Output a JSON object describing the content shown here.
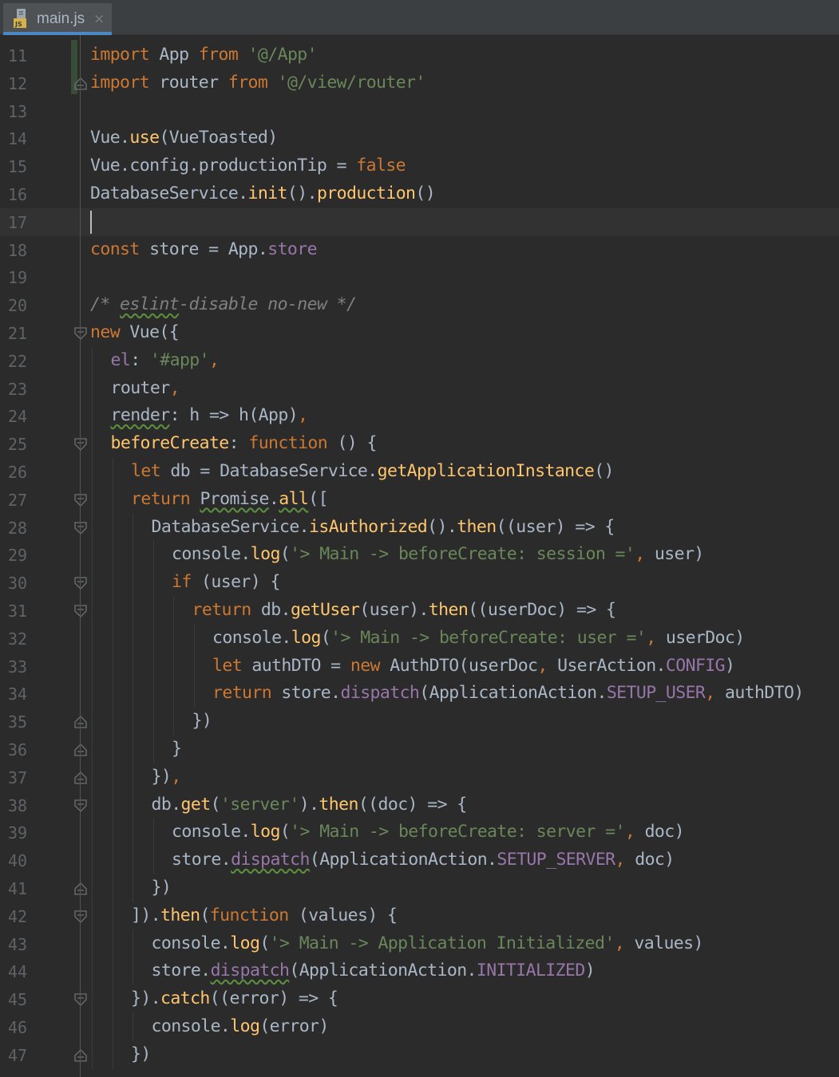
{
  "tab": {
    "file_name": "main.js",
    "icon": "js-file-icon",
    "icon_badge": "JS",
    "close_glyph": "×"
  },
  "colors": {
    "background": "#2b2b2b",
    "tab_underline": "#4a88c7",
    "keyword": "#cc7832",
    "string": "#6a8759",
    "function": "#ffc66d",
    "property": "#9876aa",
    "comment": "#808080",
    "text": "#a9b7c6"
  },
  "editor": {
    "current_line": 17,
    "lines": [
      {
        "n": "11",
        "fold": "",
        "indent": 0,
        "tokens": [
          {
            "t": "import",
            "c": "kw"
          },
          {
            "t": " App ",
            "c": "plain"
          },
          {
            "t": "from",
            "c": "kw"
          },
          {
            "t": " ",
            "c": "plain"
          },
          {
            "t": "'@/App'",
            "c": "str"
          }
        ]
      },
      {
        "n": "12",
        "fold": "end",
        "indent": 0,
        "tokens": [
          {
            "t": "import",
            "c": "kw"
          },
          {
            "t": " router ",
            "c": "plain"
          },
          {
            "t": "from",
            "c": "kw"
          },
          {
            "t": " ",
            "c": "plain"
          },
          {
            "t": "'@/view/router'",
            "c": "str"
          }
        ]
      },
      {
        "n": "13",
        "fold": "",
        "indent": 0,
        "tokens": []
      },
      {
        "n": "14",
        "fold": "",
        "indent": 0,
        "tokens": [
          {
            "t": "Vue.",
            "c": "plain"
          },
          {
            "t": "use",
            "c": "fn"
          },
          {
            "t": "(VueToasted)",
            "c": "plain"
          }
        ]
      },
      {
        "n": "15",
        "fold": "",
        "indent": 0,
        "tokens": [
          {
            "t": "Vue.config.productionTip = ",
            "c": "plain"
          },
          {
            "t": "false",
            "c": "kw"
          }
        ]
      },
      {
        "n": "16",
        "fold": "",
        "indent": 0,
        "tokens": [
          {
            "t": "DatabaseService.",
            "c": "plain"
          },
          {
            "t": "init",
            "c": "fn"
          },
          {
            "t": "().",
            "c": "plain"
          },
          {
            "t": "production",
            "c": "fn"
          },
          {
            "t": "()",
            "c": "plain"
          }
        ]
      },
      {
        "n": "17",
        "fold": "",
        "indent": 0,
        "tokens": []
      },
      {
        "n": "18",
        "fold": "",
        "indent": 0,
        "tokens": [
          {
            "t": "const",
            "c": "kw"
          },
          {
            "t": " store = App.",
            "c": "plain"
          },
          {
            "t": "store",
            "c": "prop"
          }
        ]
      },
      {
        "n": "19",
        "fold": "",
        "indent": 0,
        "tokens": []
      },
      {
        "n": "20",
        "fold": "",
        "indent": 0,
        "tokens": [
          {
            "t": "/* ",
            "c": "cm"
          },
          {
            "t": "eslint",
            "c": "cm",
            "w": true
          },
          {
            "t": "-disable no-new */",
            "c": "cm"
          }
        ]
      },
      {
        "n": "21",
        "fold": "start",
        "indent": 0,
        "tokens": [
          {
            "t": "new",
            "c": "kw"
          },
          {
            "t": " Vue({",
            "c": "plain"
          }
        ]
      },
      {
        "n": "22",
        "fold": "",
        "indent": 1,
        "tokens": [
          {
            "t": "el",
            "c": "prop"
          },
          {
            "t": ": ",
            "c": "plain"
          },
          {
            "t": "'#app'",
            "c": "str"
          },
          {
            "t": ",",
            "c": "kw"
          }
        ]
      },
      {
        "n": "23",
        "fold": "",
        "indent": 1,
        "tokens": [
          {
            "t": "router",
            "c": "plain"
          },
          {
            "t": ",",
            "c": "kw"
          }
        ]
      },
      {
        "n": "24",
        "fold": "",
        "indent": 1,
        "tokens": [
          {
            "t": "render",
            "c": "plain",
            "w": true
          },
          {
            "t": ": h => h(App)",
            "c": "plain"
          },
          {
            "t": ",",
            "c": "kw"
          }
        ]
      },
      {
        "n": "25",
        "fold": "start",
        "indent": 1,
        "tokens": [
          {
            "t": "beforeCreate",
            "c": "fn"
          },
          {
            "t": ": ",
            "c": "plain"
          },
          {
            "t": "function",
            "c": "kw"
          },
          {
            "t": " () {",
            "c": "plain"
          }
        ]
      },
      {
        "n": "26",
        "fold": "",
        "indent": 2,
        "tokens": [
          {
            "t": "let",
            "c": "kw"
          },
          {
            "t": " db = DatabaseService.",
            "c": "plain"
          },
          {
            "t": "getApplicationInstance",
            "c": "fn"
          },
          {
            "t": "()",
            "c": "plain"
          }
        ]
      },
      {
        "n": "27",
        "fold": "start",
        "indent": 2,
        "tokens": [
          {
            "t": "return",
            "c": "kw"
          },
          {
            "t": " ",
            "c": "plain"
          },
          {
            "t": "Promise",
            "c": "plain",
            "w": true
          },
          {
            "t": ".",
            "c": "plain"
          },
          {
            "t": "all",
            "c": "fn",
            "w": true
          },
          {
            "t": "([",
            "c": "plain"
          }
        ]
      },
      {
        "n": "28",
        "fold": "start",
        "indent": 3,
        "tokens": [
          {
            "t": "DatabaseService.",
            "c": "plain"
          },
          {
            "t": "isAuthorized",
            "c": "fn"
          },
          {
            "t": "().",
            "c": "plain"
          },
          {
            "t": "then",
            "c": "fn"
          },
          {
            "t": "((user) => {",
            "c": "plain"
          }
        ]
      },
      {
        "n": "29",
        "fold": "",
        "indent": 4,
        "tokens": [
          {
            "t": "console.",
            "c": "plain"
          },
          {
            "t": "log",
            "c": "fn"
          },
          {
            "t": "(",
            "c": "plain"
          },
          {
            "t": "'> Main -> beforeCreate: session ='",
            "c": "str"
          },
          {
            "t": ",",
            "c": "kw"
          },
          {
            "t": " user)",
            "c": "plain"
          }
        ]
      },
      {
        "n": "30",
        "fold": "start",
        "indent": 4,
        "tokens": [
          {
            "t": "if",
            "c": "kw"
          },
          {
            "t": " (user) {",
            "c": "plain"
          }
        ]
      },
      {
        "n": "31",
        "fold": "start",
        "indent": 5,
        "tokens": [
          {
            "t": "return",
            "c": "kw"
          },
          {
            "t": " db.",
            "c": "plain"
          },
          {
            "t": "getUser",
            "c": "fn"
          },
          {
            "t": "(user).",
            "c": "plain"
          },
          {
            "t": "then",
            "c": "fn"
          },
          {
            "t": "((userDoc) => {",
            "c": "plain"
          }
        ]
      },
      {
        "n": "32",
        "fold": "",
        "indent": 6,
        "tokens": [
          {
            "t": "console.",
            "c": "plain"
          },
          {
            "t": "log",
            "c": "fn"
          },
          {
            "t": "(",
            "c": "plain"
          },
          {
            "t": "'> Main -> beforeCreate: user ='",
            "c": "str"
          },
          {
            "t": ",",
            "c": "kw"
          },
          {
            "t": " userDoc)",
            "c": "plain"
          }
        ]
      },
      {
        "n": "33",
        "fold": "",
        "indent": 6,
        "tokens": [
          {
            "t": "let",
            "c": "kw"
          },
          {
            "t": " authDTO = ",
            "c": "plain"
          },
          {
            "t": "new",
            "c": "kw"
          },
          {
            "t": " AuthDTO(userDoc",
            "c": "plain"
          },
          {
            "t": ",",
            "c": "kw"
          },
          {
            "t": " UserAction.",
            "c": "plain"
          },
          {
            "t": "CONFIG",
            "c": "prop"
          },
          {
            "t": ")",
            "c": "plain"
          }
        ]
      },
      {
        "n": "34",
        "fold": "",
        "indent": 6,
        "tokens": [
          {
            "t": "return",
            "c": "kw"
          },
          {
            "t": " store.",
            "c": "plain"
          },
          {
            "t": "dispatch",
            "c": "prop"
          },
          {
            "t": "(ApplicationAction.",
            "c": "plain"
          },
          {
            "t": "SETUP_USER",
            "c": "prop"
          },
          {
            "t": ",",
            "c": "kw"
          },
          {
            "t": " authDTO)",
            "c": "plain"
          }
        ]
      },
      {
        "n": "35",
        "fold": "end",
        "indent": 5,
        "tokens": [
          {
            "t": "})",
            "c": "plain"
          }
        ]
      },
      {
        "n": "36",
        "fold": "end",
        "indent": 4,
        "tokens": [
          {
            "t": "}",
            "c": "plain"
          }
        ]
      },
      {
        "n": "37",
        "fold": "end",
        "indent": 3,
        "tokens": [
          {
            "t": "})",
            "c": "plain"
          },
          {
            "t": ",",
            "c": "kw"
          }
        ]
      },
      {
        "n": "38",
        "fold": "start",
        "indent": 3,
        "tokens": [
          {
            "t": "db.",
            "c": "plain"
          },
          {
            "t": "get",
            "c": "fn"
          },
          {
            "t": "(",
            "c": "plain"
          },
          {
            "t": "'server'",
            "c": "str"
          },
          {
            "t": ").",
            "c": "plain"
          },
          {
            "t": "then",
            "c": "fn"
          },
          {
            "t": "((doc) => {",
            "c": "plain"
          }
        ]
      },
      {
        "n": "39",
        "fold": "",
        "indent": 4,
        "tokens": [
          {
            "t": "console.",
            "c": "plain"
          },
          {
            "t": "log",
            "c": "fn"
          },
          {
            "t": "(",
            "c": "plain"
          },
          {
            "t": "'> Main -> beforeCreate: server ='",
            "c": "str"
          },
          {
            "t": ",",
            "c": "kw"
          },
          {
            "t": " doc)",
            "c": "plain"
          }
        ]
      },
      {
        "n": "40",
        "fold": "",
        "indent": 4,
        "tokens": [
          {
            "t": "store.",
            "c": "plain"
          },
          {
            "t": "dispatch",
            "c": "prop",
            "w": true
          },
          {
            "t": "(ApplicationAction.",
            "c": "plain"
          },
          {
            "t": "SETUP_SERVER",
            "c": "prop"
          },
          {
            "t": ",",
            "c": "kw"
          },
          {
            "t": " doc)",
            "c": "plain"
          }
        ]
      },
      {
        "n": "41",
        "fold": "end",
        "indent": 3,
        "tokens": [
          {
            "t": "})",
            "c": "plain"
          }
        ]
      },
      {
        "n": "42",
        "fold": "start",
        "indent": 2,
        "tokens": [
          {
            "t": "]).",
            "c": "plain"
          },
          {
            "t": "then",
            "c": "fn"
          },
          {
            "t": "(",
            "c": "plain"
          },
          {
            "t": "function",
            "c": "kw"
          },
          {
            "t": " (values) {",
            "c": "plain"
          }
        ]
      },
      {
        "n": "43",
        "fold": "",
        "indent": 3,
        "tokens": [
          {
            "t": "console.",
            "c": "plain"
          },
          {
            "t": "log",
            "c": "fn"
          },
          {
            "t": "(",
            "c": "plain"
          },
          {
            "t": "'> Main -> Application Initialized'",
            "c": "str"
          },
          {
            "t": ",",
            "c": "kw"
          },
          {
            "t": " values)",
            "c": "plain"
          }
        ]
      },
      {
        "n": "44",
        "fold": "",
        "indent": 3,
        "tokens": [
          {
            "t": "store.",
            "c": "plain"
          },
          {
            "t": "dispatch",
            "c": "prop",
            "w": true
          },
          {
            "t": "(ApplicationAction.",
            "c": "plain"
          },
          {
            "t": "INITIALIZED",
            "c": "prop"
          },
          {
            "t": ")",
            "c": "plain"
          }
        ]
      },
      {
        "n": "45",
        "fold": "start",
        "indent": 2,
        "tokens": [
          {
            "t": "}).",
            "c": "plain"
          },
          {
            "t": "catch",
            "c": "fn"
          },
          {
            "t": "((error) => {",
            "c": "plain"
          }
        ]
      },
      {
        "n": "46",
        "fold": "",
        "indent": 3,
        "tokens": [
          {
            "t": "console.",
            "c": "plain"
          },
          {
            "t": "log",
            "c": "fn"
          },
          {
            "t": "(error)",
            "c": "plain"
          }
        ]
      },
      {
        "n": "47",
        "fold": "end",
        "indent": 2,
        "tokens": [
          {
            "t": "})",
            "c": "plain"
          }
        ]
      }
    ]
  }
}
